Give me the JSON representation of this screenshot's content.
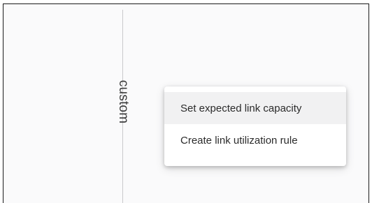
{
  "axis": {
    "label": "custom"
  },
  "context_menu": {
    "items": [
      {
        "label": "Set expected link capacity",
        "highlighted": true
      },
      {
        "label": "Create link utilization rule",
        "highlighted": false
      }
    ]
  }
}
